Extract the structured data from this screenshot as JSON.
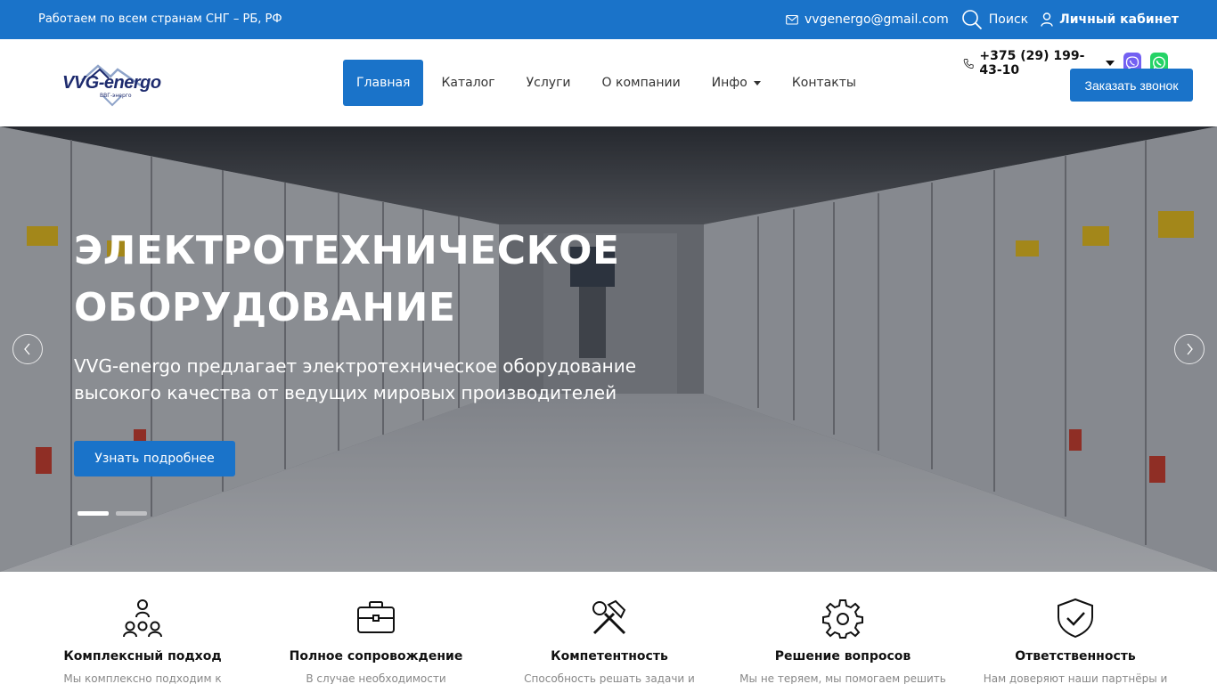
{
  "topbar": {
    "tagline": "Работаем по всем странам СНГ – РБ, РФ",
    "email": "vvgenergo@gmail.com",
    "search_label": "Поиск",
    "cabinet_label": "Личный кабинет"
  },
  "header": {
    "logo_text": "VVG-energo",
    "logo_sub": "ВВГ-энерго",
    "nav": [
      {
        "label": "Главная",
        "active": true
      },
      {
        "label": "Каталог"
      },
      {
        "label": "Услуги"
      },
      {
        "label": "О компании"
      },
      {
        "label": "Инфо",
        "dropdown": true
      },
      {
        "label": "Контакты"
      }
    ],
    "phone": "+375 (29) 199-43-10",
    "call_button": "Заказать звонок"
  },
  "hero": {
    "title_line1": "ЭЛЕКТРОТЕХНИЧЕСКОЕ",
    "title_line2": "ОБОРУДОВАНИЕ",
    "subtitle": "VVG-energo предлагает электротехническое оборудование высокого качества от ведущих мировых производителей",
    "button": "Узнать подробнее",
    "slides_total": 2,
    "active_slide": 1
  },
  "features": [
    {
      "icon": "team-icon",
      "title": "Комплексный подход",
      "desc": "Мы комплексно подходим к"
    },
    {
      "icon": "briefcase-icon",
      "title": "Полное сопровождение",
      "desc": "В случае необходимости"
    },
    {
      "icon": "tools-icon",
      "title": "Компетентность",
      "desc": "Способность решать задачи и"
    },
    {
      "icon": "gear-icon",
      "title": "Решение вопросов",
      "desc": "Мы не теряем, мы помогаем решить"
    },
    {
      "icon": "shield-check-icon",
      "title": "Ответственность",
      "desc": "Нам доверяют наши партнёры и"
    }
  ],
  "colors": {
    "brand": "#1a73c9",
    "logo": "#1e2b6e",
    "viber": "#7360f2",
    "whatsapp": "#25d366"
  }
}
